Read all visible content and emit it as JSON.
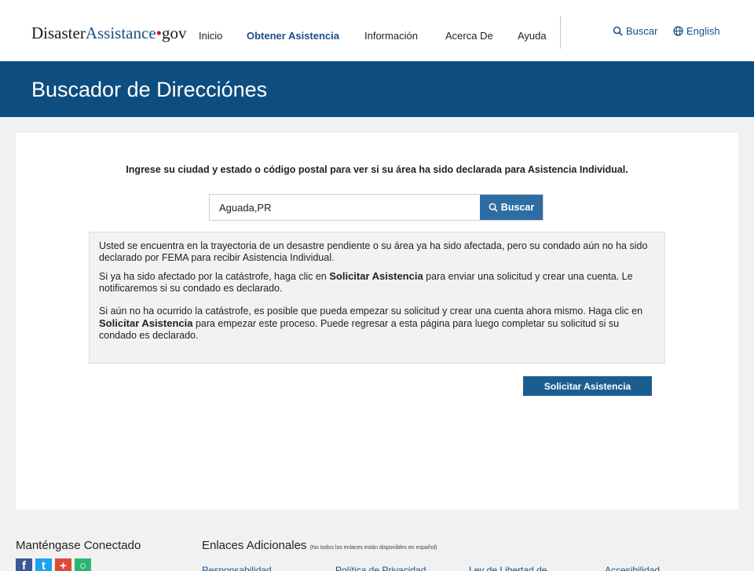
{
  "header": {
    "logo_part1": "Disaster",
    "logo_part2": "Assistance",
    "logo_dot": "•",
    "logo_gov": "gov",
    "nav": {
      "inicio": "Inicio",
      "obtener": "Obtener Asistencia",
      "informacion": "Información",
      "acerca": "Acerca De",
      "ayuda": "Ayuda"
    },
    "search_link": "Buscar",
    "language_link": "English"
  },
  "banner": {
    "title": "Buscador de Direcciónes"
  },
  "main": {
    "prompt": "Ingrese su ciudad y estado o código postal para ver si su área ha sido declarada para Asistencia Individual.",
    "search": {
      "value": "Aguada,PR",
      "button": "Buscar"
    },
    "notice": {
      "p1": "Usted se encuentra en la trayectoria de un desastre pendiente o su área ya ha sido afectada, pero su condado aún no ha sido declarado por FEMA para recibir Asistencia Individual.",
      "p2_before": "Si ya ha sido afectado por la catástrofe, haga clic en ",
      "p2_bold": "Solicitar Asistencia",
      "p2_after": " para enviar una solicitud y crear una cuenta. Le notificaremos si su condado es declarado.",
      "p3_before": "Si aún no ha ocurrido la catástrofe, es posible que pueda empezar su solicitud y crear una cuenta ahora mismo. Haga clic en ",
      "p3_bold": "Solicitar Asistencia",
      "p3_after": " para empezar este proceso. Puede regresar a esta página para luego completar su solicitud si su condado es declarado."
    },
    "apply_button": "Solicitar Asistencia"
  },
  "footer": {
    "stay_connected": "Manténgase Conectado",
    "links_title": "Enlaces Adicionales",
    "links_note": "(No todos los enlaces están disponibles en español)",
    "links": {
      "responsabilidad": "Responsabilidad",
      "privacidad": "Política de Privacidad",
      "libertad": "Ley de Libertad de",
      "accesibilidad": "Accesibilidad"
    },
    "social": {
      "facebook": {
        "glyph": "f",
        "color": "#3b5998"
      },
      "twitter": {
        "glyph": "t",
        "color": "#1da1f2"
      },
      "plus": {
        "glyph": "+",
        "color": "#dd4b39"
      },
      "chat": {
        "glyph": "○",
        "color": "#2bb673"
      }
    }
  },
  "colors": {
    "banner": "#0e4d7f",
    "accent": "#1a4f86",
    "search_button": "#2e6da4",
    "apply_button": "#1a5e91"
  }
}
